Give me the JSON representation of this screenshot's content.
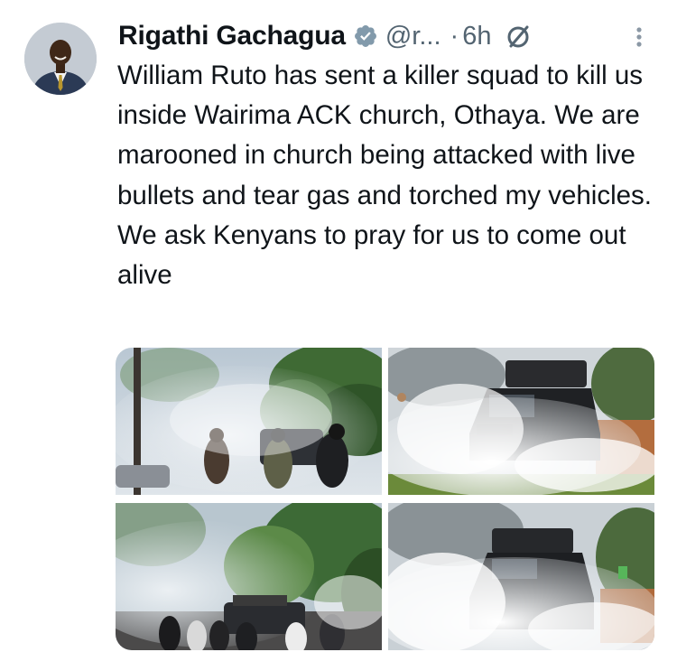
{
  "tweet": {
    "author": {
      "display_name": "Rigathi Gachagua",
      "handle": "@r...",
      "verified": true,
      "avatar_icon": "profile-photo"
    },
    "separator": "·",
    "time": "6h",
    "muted_icon": "slashed-circle-icon",
    "more_icon": "vertical-ellipsis-icon",
    "text": "William Ruto has sent a killer squad to kill us inside Wairima ACK church, Othaya. We are marooned in church being attacked with live bullets and tear gas and torched my vehicles. We ask Kenyans to pray for us to come out alive",
    "media": [
      {
        "name": "photo-1",
        "subject": "tear gas smoke with people and trees"
      },
      {
        "name": "photo-2",
        "subject": "black vehicle in tear gas smoke"
      },
      {
        "name": "photo-3",
        "subject": "crowd and vehicle under tear gas near trees"
      },
      {
        "name": "photo-4",
        "subject": "vehicle engulfed in white smoke"
      }
    ]
  },
  "colors": {
    "text_primary": "#0f1419",
    "text_secondary": "#536471",
    "verified_badge": "#829aab"
  }
}
